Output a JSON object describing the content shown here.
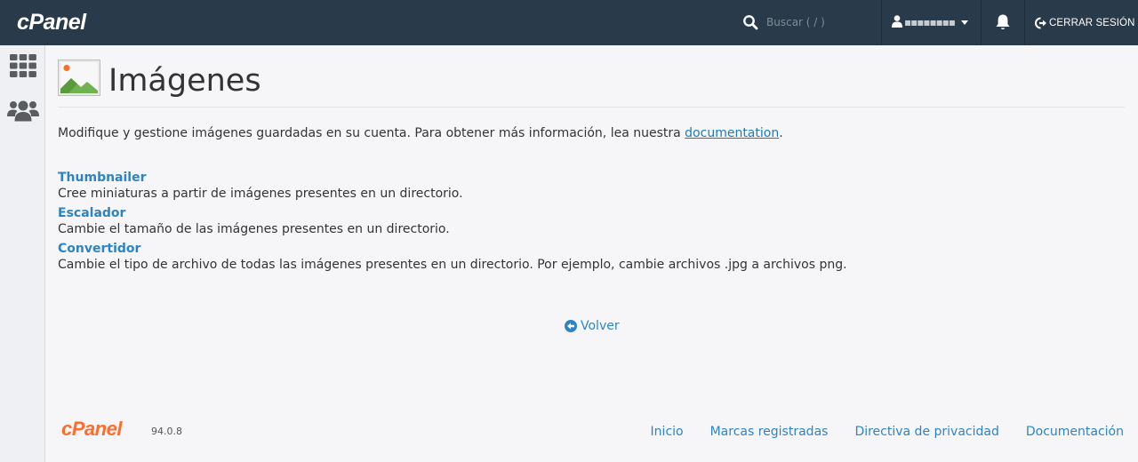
{
  "header": {
    "logo": "cPanel",
    "search_placeholder": "Buscar ( / )",
    "user_name": "▪▪▪▪▪▪▪▪",
    "logout_label": "CERRAR SESIÓN"
  },
  "sidebar": {
    "items": [
      {
        "icon": "grid-icon"
      },
      {
        "icon": "users-icon"
      }
    ]
  },
  "page": {
    "title": "Imágenes",
    "intro_text": "Modifique y gestione imágenes guardadas en su cuenta. Para obtener más información, lea nuestra ",
    "intro_link": "documentation",
    "intro_end": "."
  },
  "features": [
    {
      "title": "Thumbnailer",
      "description": "Cree miniaturas a partir de imágenes presentes en un directorio."
    },
    {
      "title": "Escalador",
      "description": "Cambie el tamaño de las imágenes presentes en un directorio."
    },
    {
      "title": "Convertidor",
      "description": "Cambie el tipo de archivo de todas las imágenes presentes en un directorio. Por ejemplo, cambie archivos .jpg a archivos png."
    }
  ],
  "back_label": "Volver",
  "footer": {
    "logo": "cPanel",
    "version": "94.0.8",
    "links": [
      "Inicio",
      "Marcas registradas",
      "Directiva de privacidad",
      "Documentación"
    ]
  },
  "colors": {
    "topbar": "#293a4a",
    "link": "#2e84c1",
    "brand_orange": "#ff6c2c"
  }
}
